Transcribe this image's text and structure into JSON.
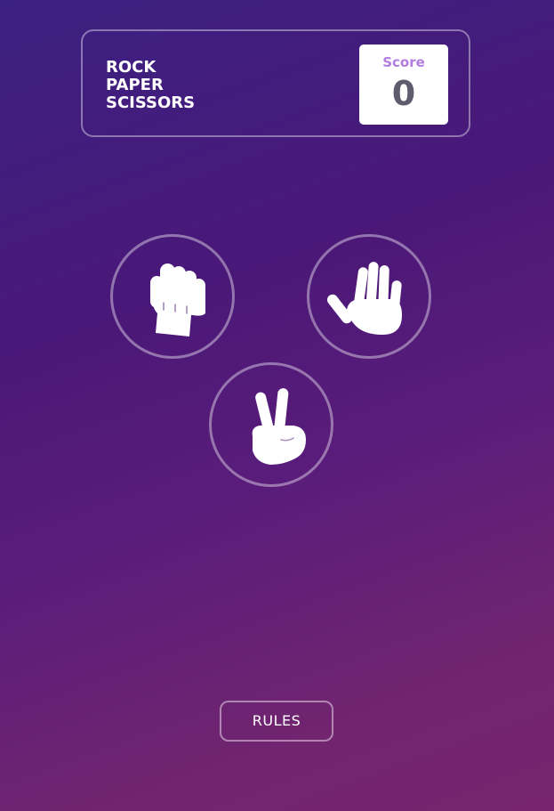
{
  "header": {
    "title_lines": [
      "ROCK",
      "PAPER",
      "SCISSORS"
    ],
    "score_label": "Score",
    "score_value": "0"
  },
  "choices": [
    {
      "id": "rock",
      "icon": "rock-hand-icon"
    },
    {
      "id": "paper",
      "icon": "paper-hand-icon"
    },
    {
      "id": "scissors",
      "icon": "scissors-hand-icon"
    }
  ],
  "footer": {
    "rules_label": "RULES"
  },
  "colors": {
    "background_start": "#3b2182",
    "background_end": "#76246e",
    "score_label": "#b27ce0",
    "score_value": "#5e5b6d"
  }
}
